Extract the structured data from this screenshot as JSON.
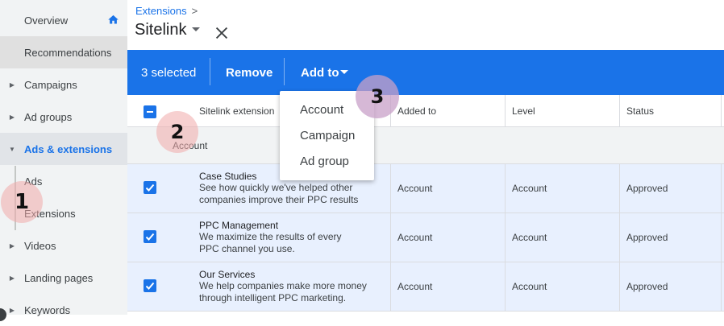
{
  "sidebar": {
    "items": [
      {
        "label": "Overview"
      },
      {
        "label": "Recommendations"
      },
      {
        "label": "Campaigns"
      },
      {
        "label": "Ad groups"
      },
      {
        "label": "Ads & extensions"
      },
      {
        "label": "Ads"
      },
      {
        "label": "Extensions"
      },
      {
        "label": "Videos"
      },
      {
        "label": "Landing pages"
      },
      {
        "label": "Keywords"
      }
    ]
  },
  "header": {
    "breadcrumb": "Extensions",
    "breadcrumb_sep": ">",
    "title": "Sitelink"
  },
  "selection_bar": {
    "count_text": "3 selected",
    "remove_label": "Remove",
    "add_to_label": "Add to"
  },
  "add_to_menu": {
    "options": [
      "Account",
      "Campaign",
      "Ad group"
    ]
  },
  "table": {
    "columns": [
      "Sitelink extension",
      "Added to",
      "Level",
      "Status"
    ],
    "group_label": "Account",
    "rows": [
      {
        "name": "Case Studies",
        "desc1": "See how quickly we've helped other",
        "desc2": "companies improve their PPC results",
        "added_to": "Account",
        "level": "Account",
        "status": "Approved"
      },
      {
        "name": "PPC Management",
        "desc1": "We maximize the results of every",
        "desc2": "PPC channel you use.",
        "added_to": "Account",
        "level": "Account",
        "status": "Approved"
      },
      {
        "name": "Our Services",
        "desc1": "We help companies make more money",
        "desc2": "through intelligent PPC marketing.",
        "added_to": "Account",
        "level": "Account",
        "status": "Approved"
      }
    ]
  },
  "markers": [
    "1",
    "2",
    "3"
  ],
  "colors": {
    "accent": "#1a73e8",
    "sidebar_bg": "#f1f3f4",
    "selected_row": "#e8f0fe"
  }
}
